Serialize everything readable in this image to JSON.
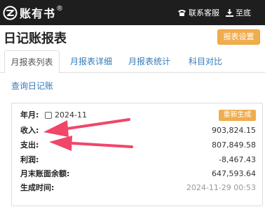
{
  "header": {
    "logo_text": "账有书",
    "logo_mark": "®",
    "contact_label": "联系客服",
    "bottom_label": "至底"
  },
  "page": {
    "title": "日记账报表",
    "settings_button": "报表设置"
  },
  "tabs": [
    {
      "label": "月报表列表"
    },
    {
      "label": "月报表详细"
    },
    {
      "label": "月报表统计"
    },
    {
      "label": "科目对比"
    }
  ],
  "query_link": "查询日记账",
  "report": {
    "month_label": "年月:",
    "month_value": "2024-11",
    "month_checked": false,
    "regenerate_button": "重新生成",
    "income_label": "收入:",
    "income_value": "903,824.15",
    "expense_label": "支出:",
    "expense_value": "807,849.58",
    "profit_label": "利润:",
    "profit_value": "-8,467.43",
    "balance_label": "月末账面余额:",
    "balance_value": "647,593.64",
    "generated_label": "生成时间:",
    "generated_value": "2024-11-29 00:53"
  },
  "colors": {
    "topbar": "#1e1e1e",
    "accent_button": "#f0ad4e",
    "link": "#337ab7",
    "annotation_arrow": "#f0466a"
  },
  "icons": [
    "logo-icon",
    "phone-icon",
    "download-icon",
    "checkbox-icon",
    "annotation-arrow-icon"
  ]
}
